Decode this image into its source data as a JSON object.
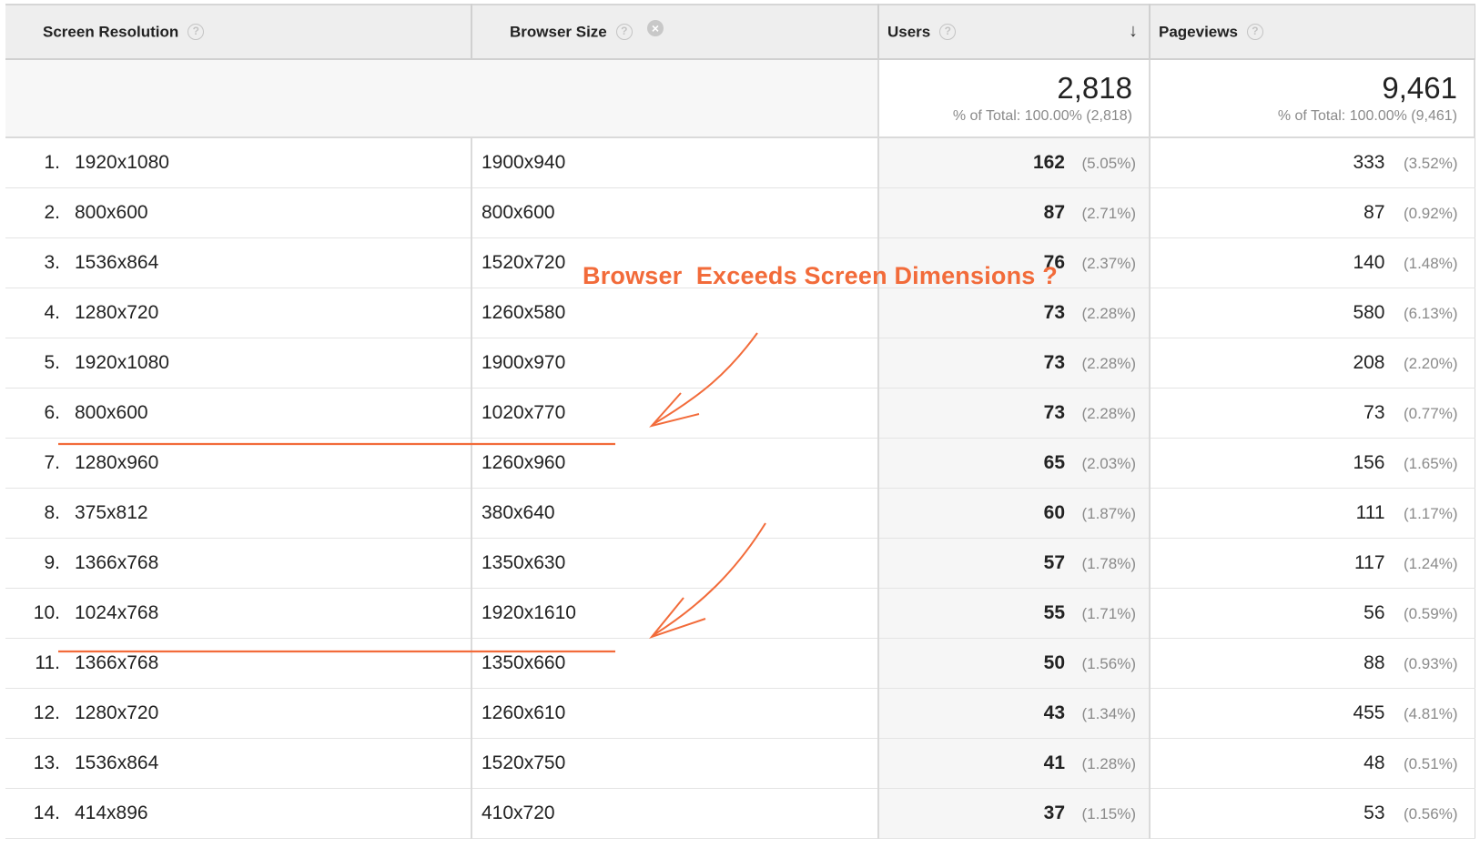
{
  "headers": {
    "screen_resolution": "Screen Resolution",
    "browser_size": "Browser Size",
    "users": "Users",
    "pageviews": "Pageviews",
    "help_glyph": "?",
    "close_glyph": "×",
    "sort_glyph": "↓"
  },
  "totals": {
    "users": "2,818",
    "users_sub": "% of Total: 100.00% (2,818)",
    "pageviews": "9,461",
    "pageviews_sub": "% of Total: 100.00% (9,461)"
  },
  "rows": [
    {
      "idx": "1.",
      "res": "1920x1080",
      "size": "1900x940",
      "users": "162",
      "users_pct": "(5.05%)",
      "pv": "333",
      "pv_pct": "(3.52%)"
    },
    {
      "idx": "2.",
      "res": "800x600",
      "size": "800x600",
      "users": "87",
      "users_pct": "(2.71%)",
      "pv": "87",
      "pv_pct": "(0.92%)"
    },
    {
      "idx": "3.",
      "res": "1536x864",
      "size": "1520x720",
      "users": "76",
      "users_pct": "(2.37%)",
      "pv": "140",
      "pv_pct": "(1.48%)"
    },
    {
      "idx": "4.",
      "res": "1280x720",
      "size": "1260x580",
      "users": "73",
      "users_pct": "(2.28%)",
      "pv": "580",
      "pv_pct": "(6.13%)"
    },
    {
      "idx": "5.",
      "res": "1920x1080",
      "size": "1900x970",
      "users": "73",
      "users_pct": "(2.28%)",
      "pv": "208",
      "pv_pct": "(2.20%)"
    },
    {
      "idx": "6.",
      "res": "800x600",
      "size": "1020x770",
      "users": "73",
      "users_pct": "(2.28%)",
      "pv": "73",
      "pv_pct": "(0.77%)"
    },
    {
      "idx": "7.",
      "res": "1280x960",
      "size": "1260x960",
      "users": "65",
      "users_pct": "(2.03%)",
      "pv": "156",
      "pv_pct": "(1.65%)"
    },
    {
      "idx": "8.",
      "res": "375x812",
      "size": "380x640",
      "users": "60",
      "users_pct": "(1.87%)",
      "pv": "111",
      "pv_pct": "(1.17%)"
    },
    {
      "idx": "9.",
      "res": "1366x768",
      "size": "1350x630",
      "users": "57",
      "users_pct": "(1.78%)",
      "pv": "117",
      "pv_pct": "(1.24%)"
    },
    {
      "idx": "10.",
      "res": "1024x768",
      "size": "1920x1610",
      "users": "55",
      "users_pct": "(1.71%)",
      "pv": "56",
      "pv_pct": "(0.59%)"
    },
    {
      "idx": "11.",
      "res": "1366x768",
      "size": "1350x660",
      "users": "50",
      "users_pct": "(1.56%)",
      "pv": "88",
      "pv_pct": "(0.93%)"
    },
    {
      "idx": "12.",
      "res": "1280x720",
      "size": "1260x610",
      "users": "43",
      "users_pct": "(1.34%)",
      "pv": "455",
      "pv_pct": "(4.81%)"
    },
    {
      "idx": "13.",
      "res": "1536x864",
      "size": "1520x750",
      "users": "41",
      "users_pct": "(1.28%)",
      "pv": "48",
      "pv_pct": "(0.51%)"
    },
    {
      "idx": "14.",
      "res": "414x896",
      "size": "410x720",
      "users": "37",
      "users_pct": "(1.15%)",
      "pv": "53",
      "pv_pct": "(0.56%)"
    }
  ],
  "annotation": {
    "text": "Browser  Exceeds Screen Dimensions ?",
    "color": "#f26b3a"
  }
}
